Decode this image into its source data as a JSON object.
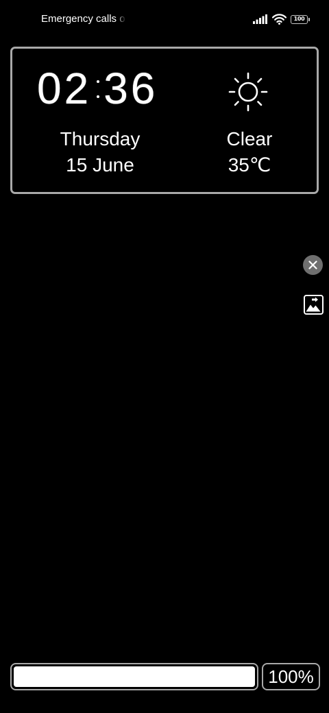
{
  "status_bar": {
    "carrier_text": "Emergency calls only",
    "battery_level": "100",
    "icons": [
      "signal-icon",
      "wifi-icon",
      "battery-icon"
    ]
  },
  "widget": {
    "time_hours": "02",
    "time_minutes": "36",
    "weekday": "Thursday",
    "date": "15 June",
    "weather_icon": "sun-icon",
    "condition": "Clear",
    "temperature": "35℃"
  },
  "side_buttons": {
    "close_icon": "close-icon",
    "wallpaper_icon": "wallpaper-change-icon"
  },
  "bottom": {
    "progress_fraction": 1.0,
    "progress_label": "100%"
  },
  "colors": {
    "background": "#000000",
    "text": "#ffffff",
    "border": "#a9a9a9",
    "close_button": "#6f6f6f"
  }
}
